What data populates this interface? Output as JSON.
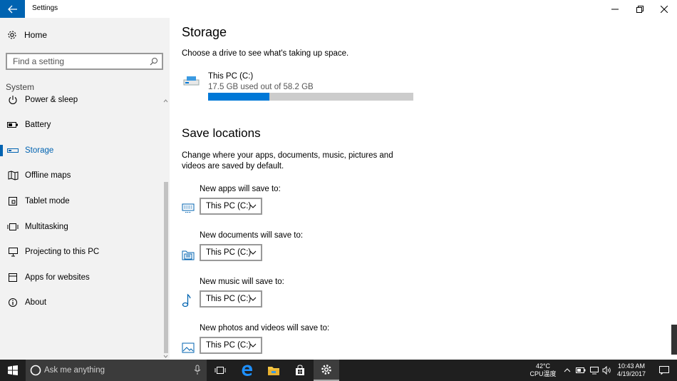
{
  "window": {
    "title": "Settings"
  },
  "sidebar": {
    "home_label": "Home",
    "search_placeholder": "Find a setting",
    "section_label": "System",
    "items": [
      {
        "label": "Power & sleep",
        "icon": "power-icon"
      },
      {
        "label": "Battery",
        "icon": "battery-icon"
      },
      {
        "label": "Storage",
        "icon": "storage-icon",
        "selected": true
      },
      {
        "label": "Offline maps",
        "icon": "map-icon"
      },
      {
        "label": "Tablet mode",
        "icon": "tablet-icon"
      },
      {
        "label": "Multitasking",
        "icon": "multitasking-icon"
      },
      {
        "label": "Projecting to this PC",
        "icon": "projecting-icon"
      },
      {
        "label": "Apps for websites",
        "icon": "apps-websites-icon"
      },
      {
        "label": "About",
        "icon": "info-icon"
      }
    ]
  },
  "main": {
    "title": "Storage",
    "description": "Choose a drive to see what's taking up space.",
    "drive": {
      "name": "This PC (C:)",
      "usage": "17.5 GB used out of 58.2 GB",
      "used_fraction": 0.3
    },
    "save_locations": {
      "title": "Save locations",
      "description": "Change where your apps, documents, music, pictures and videos are saved by default.",
      "rows": [
        {
          "label": "New apps will save to:",
          "value": "This PC (C:)",
          "icon": "monitor-icon"
        },
        {
          "label": "New documents will save to:",
          "value": "This PC (C:)",
          "icon": "documents-folder-icon"
        },
        {
          "label": "New music will save to:",
          "value": "This PC (C:)",
          "icon": "music-note-icon"
        },
        {
          "label": "New photos and videos will save to:",
          "value": "This PC (C:)",
          "icon": "picture-icon"
        }
      ]
    }
  },
  "taskbar": {
    "search_placeholder": "Ask me anything",
    "temperature": "42°C",
    "cpu_label": "CPU温度",
    "time": "10:43 AM",
    "date": "4/19/2017"
  },
  "colors": {
    "accent": "#0063b1",
    "bar_fill": "#0078d7",
    "taskbar": "#1f1f1f",
    "sidebar": "#f2f2f2"
  }
}
